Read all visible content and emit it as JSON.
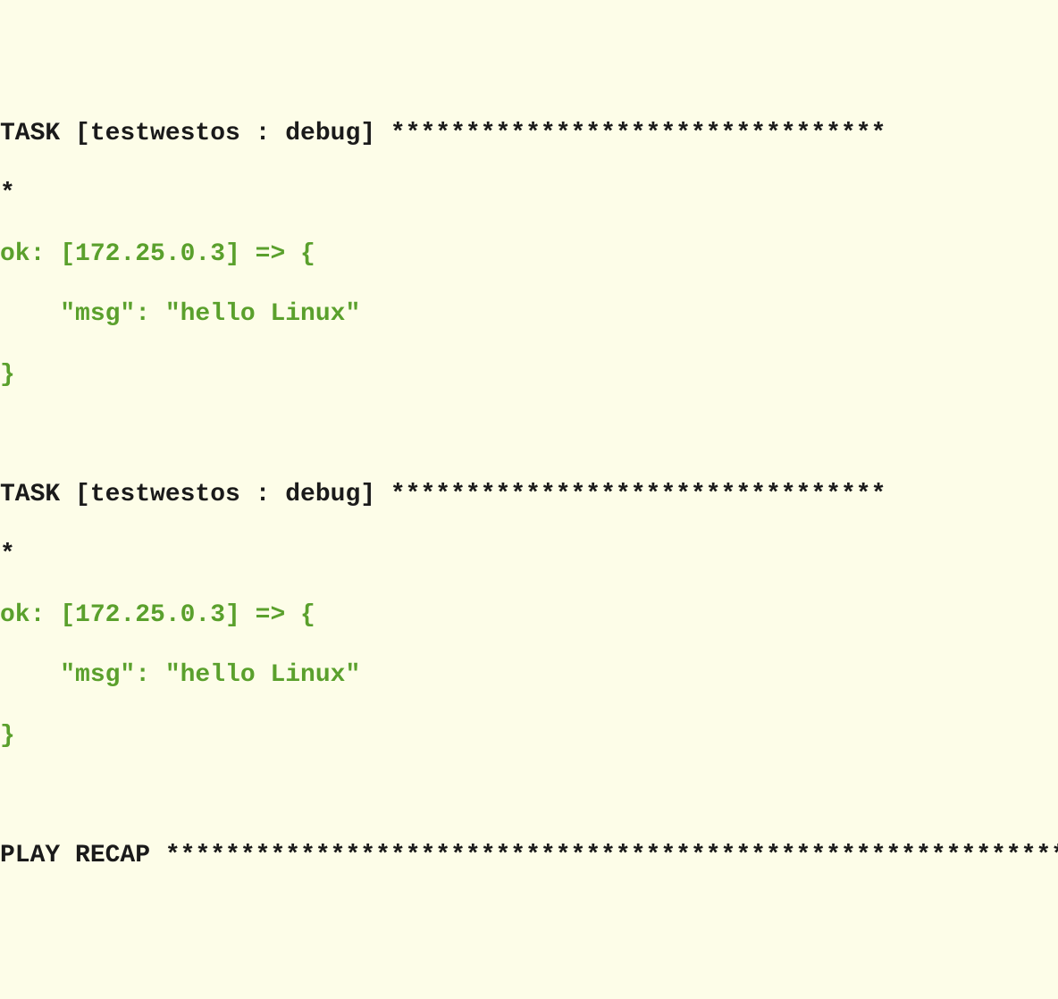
{
  "tasks": [
    {
      "header": "TASK [testwestos : debug] ",
      "stars1": "*********************************",
      "stars2": "*",
      "ok_line": "ok: [172.25.0.3] => {",
      "msg_line": "    \"msg\": \"hello Linux\"",
      "close_line": "}"
    },
    {
      "header": "TASK [testwestos : debug] ",
      "stars1": "*********************************",
      "stars2": "*",
      "ok_line": "ok: [172.25.0.3] => {",
      "msg_line": "    \"msg\": \"hello Linux\"",
      "close_line": "}"
    }
  ],
  "recap": {
    "label": "PLAY RECAP ",
    "stars": "*************************************************************"
  }
}
